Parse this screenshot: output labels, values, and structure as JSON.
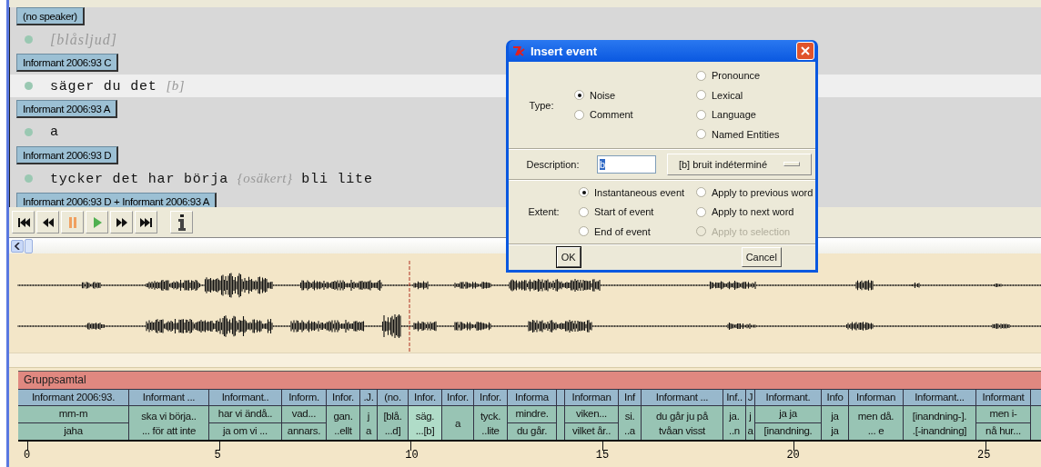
{
  "transcript": [
    {
      "speaker": "(no speaker)",
      "utterance": {
        "kind": "event",
        "text": "[blåsljud]",
        "selected": false
      }
    },
    {
      "speaker": "Informant 2006:93 C",
      "utterance": {
        "kind": "speech",
        "text": "säger du det *[b]*",
        "selected": true
      }
    },
    {
      "speaker": "Informant 2006:93 A",
      "utterance": {
        "kind": "speech",
        "text": "a",
        "selected": false
      }
    },
    {
      "speaker": "Informant 2006:93 D",
      "utterance": {
        "kind": "speech",
        "text": "tycker det har börja *{osäkert}* bli lite",
        "selected": false
      }
    },
    {
      "speaker": "Informant 2006:93 D + Informant 2006:93 A"
    }
  ],
  "tier": {
    "name": "Gruppsamtal",
    "segments": [
      {
        "speaker": "Informant 2006:93.",
        "kind": "split",
        "lines": [
          "mm-m",
          "jaha"
        ],
        "selected": false
      },
      {
        "speaker": "Informant ...",
        "kind": "merged",
        "lines": [
          "ska vi börja..",
          "... för att inte"
        ],
        "selected": false
      },
      {
        "speaker": "Informant..",
        "kind": "split",
        "lines": [
          "har vi ändå..",
          "ja om vi ..."
        ],
        "selected": false
      },
      {
        "speaker": "Inform.",
        "kind": "split",
        "lines": [
          "vad...",
          "annars."
        ],
        "selected": false
      },
      {
        "speaker": "Infor.",
        "kind": "merged",
        "lines": [
          "gan.",
          "..ellt"
        ],
        "selected": false
      },
      {
        "speaker": ".J.",
        "kind": "merged",
        "lines": [
          "j",
          "a"
        ],
        "selected": false
      },
      {
        "speaker": "(no.",
        "kind": "merged",
        "lines": [
          "[blå.",
          "...d]"
        ],
        "selected": false
      },
      {
        "speaker": "Infor.",
        "kind": "merged",
        "lines": [
          "säg.",
          "...[b]"
        ],
        "selected": true
      },
      {
        "speaker": "Infor.",
        "kind": "single",
        "lines": [
          "a"
        ],
        "selected": false
      },
      {
        "speaker": "Infor.",
        "kind": "merged",
        "lines": [
          "tyck.",
          "..lite"
        ],
        "selected": false
      },
      {
        "speaker": "Informa",
        "kind": "split",
        "lines": [
          "mindre.",
          "du går."
        ],
        "selected": false
      },
      {
        "kind": "empty",
        "selected": false
      },
      {
        "speaker": "Informan",
        "kind": "split",
        "lines": [
          "viken...",
          "vilket år.."
        ],
        "selected": false
      },
      {
        "speaker": "Inf",
        "kind": "merged",
        "lines": [
          "si.",
          "..a"
        ],
        "selected": false
      },
      {
        "speaker": "Informant ...",
        "kind": "merged",
        "lines": [
          "du går ju på",
          "tvåan visst"
        ],
        "selected": false
      },
      {
        "speaker": "Inf..",
        "kind": "merged",
        "lines": [
          "ja.",
          "..n"
        ],
        "selected": false
      },
      {
        "speaker": "J",
        "kind": "merged",
        "lines": [
          "j",
          "a"
        ],
        "selected": false
      },
      {
        "speaker": "Informant.",
        "kind": "split",
        "lines": [
          "ja ja",
          "[inandning."
        ],
        "selected": false
      },
      {
        "speaker": "Info",
        "kind": "merged",
        "lines": [
          "ja",
          "ja"
        ],
        "selected": false
      },
      {
        "speaker": "Informan",
        "kind": "merged",
        "lines": [
          "men då.",
          "... e"
        ],
        "selected": false
      },
      {
        "speaker": "Informant...",
        "kind": "merged",
        "lines": [
          "[inandning-].",
          ".[-inandning]"
        ],
        "selected": false
      },
      {
        "speaker": "Informant",
        "kind": "split",
        "lines": [
          "men i-",
          "nå hur..."
        ],
        "selected": false
      }
    ]
  },
  "axis": {
    "ticks": [
      "0",
      "5",
      "10",
      "15",
      "20",
      "25"
    ]
  },
  "dialog": {
    "title": "Insert event",
    "type": {
      "label": "Type:",
      "columns": [
        [
          {
            "label": "Noise",
            "selected": true
          },
          {
            "label": "Comment",
            "selected": false
          }
        ],
        [
          {
            "label": "Pronounce",
            "selected": false
          },
          {
            "label": "Lexical",
            "selected": false
          },
          {
            "label": "Language",
            "selected": false
          },
          {
            "label": "Named Entities",
            "selected": false
          }
        ]
      ]
    },
    "description": {
      "label": "Description:",
      "value": "b",
      "menu": "[b] bruit indéterminé"
    },
    "extent": {
      "label": "Extent:",
      "columns": [
        [
          {
            "label": "Instantaneous event",
            "selected": true,
            "disabled": false
          },
          {
            "label": "Start of event",
            "selected": false,
            "disabled": false
          },
          {
            "label": "End of event",
            "selected": false,
            "disabled": false
          }
        ],
        [
          {
            "label": "Apply to previous word",
            "selected": false,
            "disabled": false
          },
          {
            "label": "Apply to next word",
            "selected": false,
            "disabled": false
          },
          {
            "label": "Apply to selection",
            "selected": false,
            "disabled": true
          }
        ]
      ]
    },
    "buttons": [
      "OK",
      "Cancel"
    ]
  }
}
